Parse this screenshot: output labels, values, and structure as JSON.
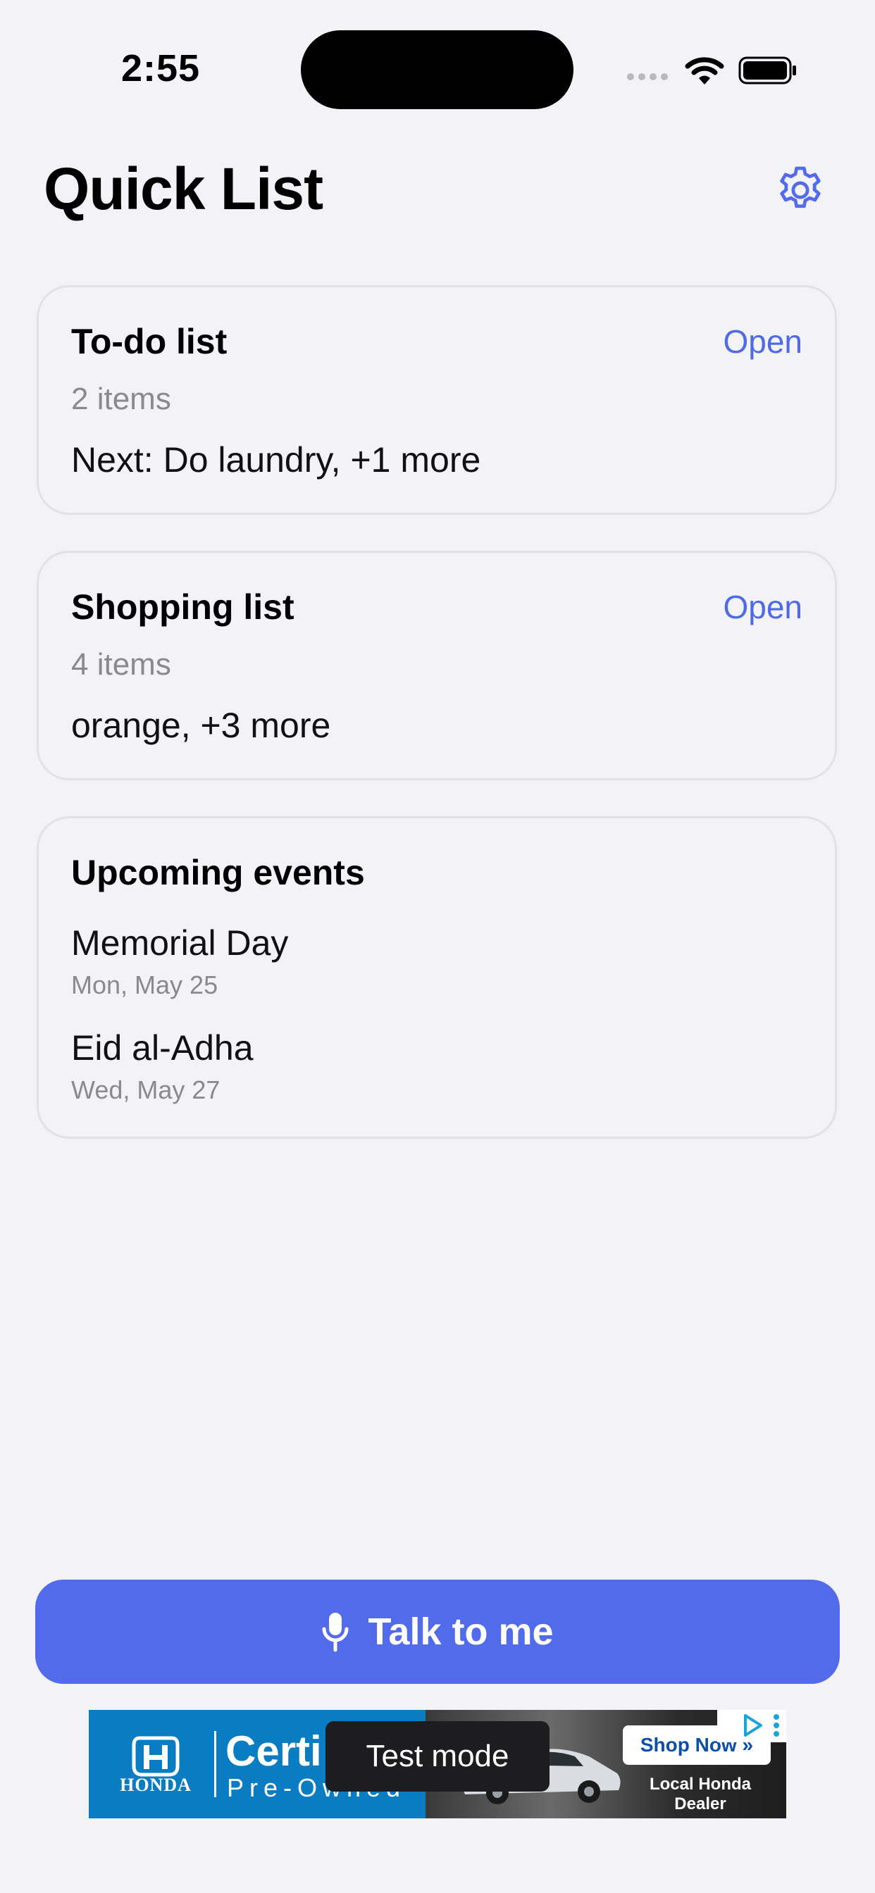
{
  "status_bar": {
    "time": "2:55"
  },
  "header": {
    "title": "Quick List",
    "settings_icon": "gear-icon"
  },
  "cards": {
    "todo": {
      "title": "To-do list",
      "open_label": "Open",
      "count": "2 items",
      "preview": "Next: Do laundry, +1 more"
    },
    "shopping": {
      "title": "Shopping list",
      "open_label": "Open",
      "count": "4 items",
      "preview": "orange, +3 more"
    },
    "events": {
      "title": "Upcoming events",
      "items": [
        {
          "name": "Memorial Day",
          "date": "Mon, May 25"
        },
        {
          "name": "Eid al-Adha",
          "date": "Wed, May 27"
        }
      ]
    }
  },
  "talk_button": {
    "label": "Talk to me",
    "icon": "microphone-icon"
  },
  "ad": {
    "brand": "HONDA",
    "headline": "Certi",
    "subline": "Pre-Owned",
    "shop_label": "Shop Now »",
    "dealer_label": "Local Honda Dealer",
    "test_mode_label": "Test mode"
  },
  "colors": {
    "accent": "#526bea",
    "link": "#4f6ae6",
    "background": "#f2f2f7"
  }
}
